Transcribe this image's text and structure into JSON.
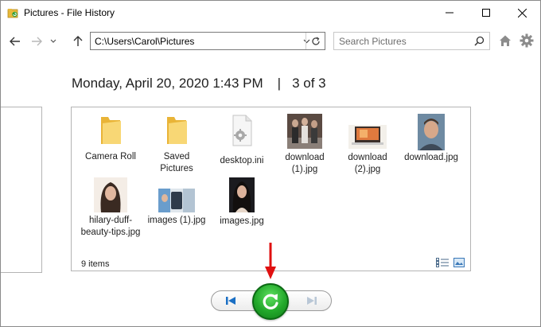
{
  "window": {
    "title": "Pictures - File History"
  },
  "toolbar": {
    "address": "C:\\Users\\Carol\\Pictures",
    "search_placeholder": "Search Pictures"
  },
  "main": {
    "date": "Monday, April 20, 2020 1:43 PM",
    "separator": "|",
    "position": "3 of 3",
    "item_count": "9 items",
    "items": [
      {
        "label": "Camera Roll",
        "type": "folder"
      },
      {
        "label": "Saved Pictures",
        "type": "folder"
      },
      {
        "label": "desktop.ini",
        "type": "settings-file"
      },
      {
        "label": "download (1).jpg",
        "type": "image"
      },
      {
        "label": "download (2).jpg",
        "type": "image"
      },
      {
        "label": "download.jpg",
        "type": "image"
      },
      {
        "label": "hilary-duff-beauty-tips.jpg",
        "type": "image"
      },
      {
        "label": "images (1).jpg",
        "type": "image"
      },
      {
        "label": "images.jpg",
        "type": "image"
      }
    ]
  },
  "colors": {
    "folder": "#f2c94c",
    "restore": "#22a82a",
    "arrow": "#e01010",
    "nav_button": "#1a6fc4"
  }
}
